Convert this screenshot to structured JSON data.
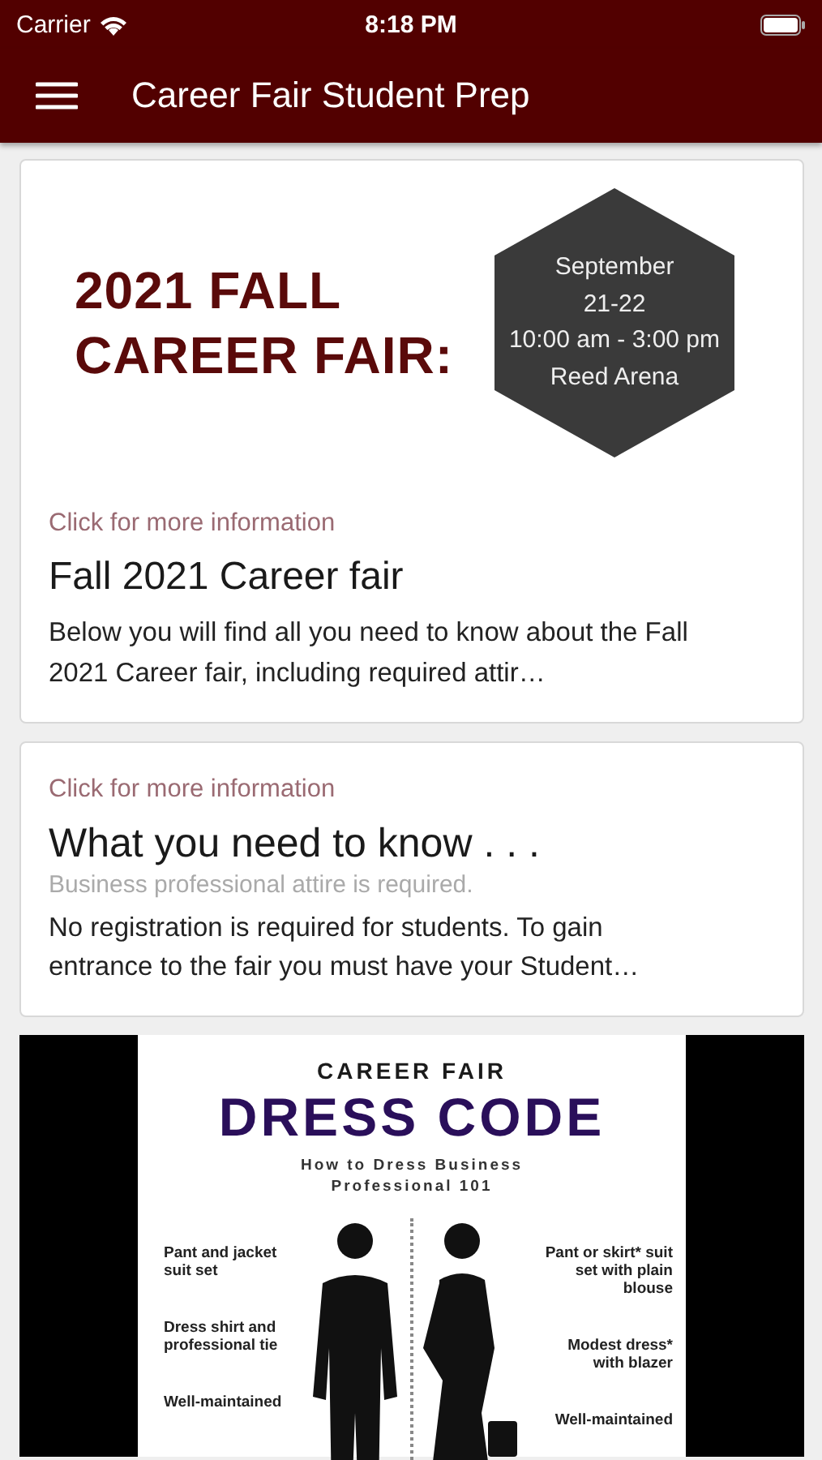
{
  "status_bar": {
    "carrier": "Carrier",
    "time": "8:18 PM"
  },
  "app_bar": {
    "title": "Career Fair Student Prep"
  },
  "cards": [
    {
      "kind": "banner_article",
      "banner": {
        "headline_lines": [
          "2021 FALL",
          "CAREER FAIR:"
        ],
        "badge_lines": [
          "September",
          "21-22",
          "10:00 am - 3:00 pm",
          "Reed Arena"
        ]
      },
      "link": "Click for more information",
      "title": "Fall 2021 Career fair",
      "body": "Below you will find all you need to know about the Fall 2021 Career fair, including required attir…"
    },
    {
      "kind": "article",
      "link": "Click for more information",
      "title": "What you need to know . . .",
      "subtitle": "Business professional attire is required.",
      "body": "No registration is required for students. To gain entrance to the fair you must have your Student…"
    },
    {
      "kind": "infographic",
      "overline": "CAREER FAIR",
      "heading": "DRESS CODE",
      "subheading": "How to Dress Business Professional 101",
      "left_notes": [
        "Pant and jacket suit set",
        "Dress shirt and professional tie",
        "Well-maintained"
      ],
      "right_notes": [
        "Pant or skirt* suit set with plain blouse",
        "Modest dress* with blazer",
        "Well-maintained"
      ]
    }
  ]
}
